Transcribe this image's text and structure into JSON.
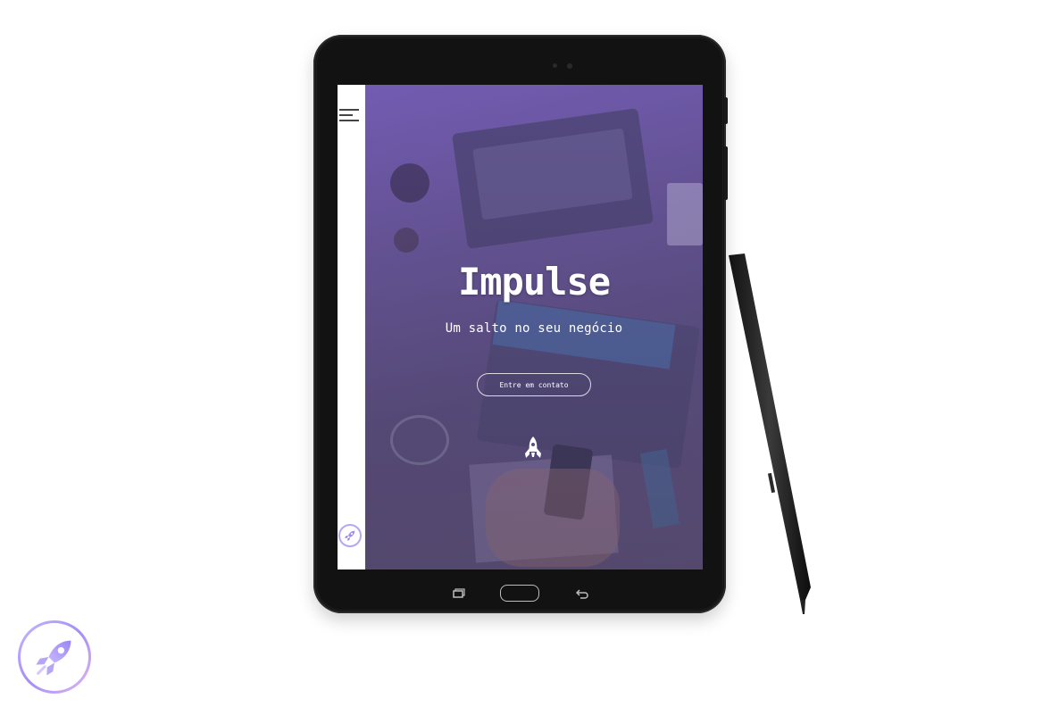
{
  "site": {
    "title": "Impulse",
    "subtitle": "Um salto no seu negócio",
    "cta_label": "Entre em contato"
  },
  "icons": {
    "menu": "hamburger-menu-icon",
    "brand": "rocket-icon",
    "hero_mark": "rocket-icon",
    "tablet_nav": [
      "recent-apps-icon",
      "home-button",
      "back-icon"
    ]
  },
  "colors": {
    "accent": "#a48df5",
    "hero_tint": "#6f5aa6",
    "text_on_hero": "#ffffff",
    "device": "#121212"
  }
}
